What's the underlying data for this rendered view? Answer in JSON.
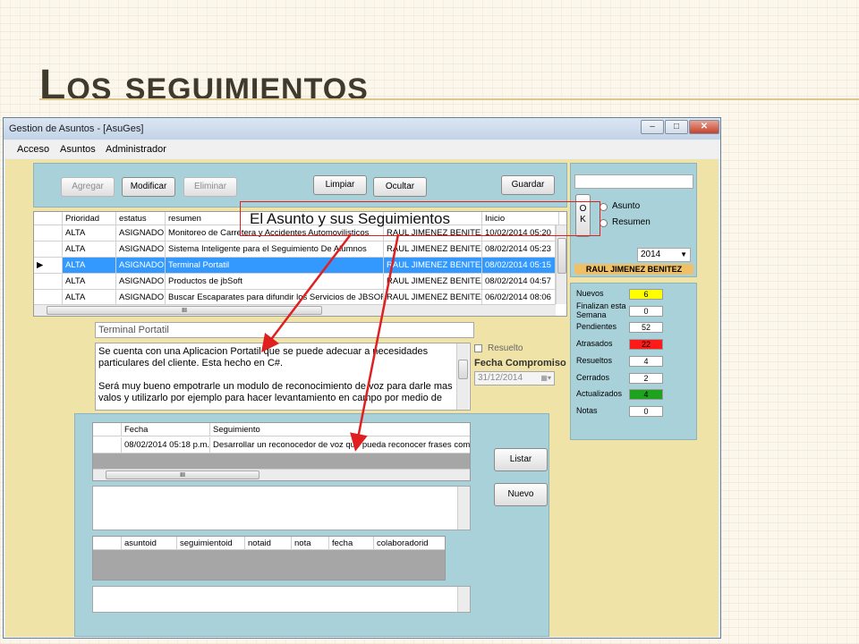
{
  "slide": {
    "title": "Los seguimientos",
    "callout": "El Asunto y sus Seguimientos"
  },
  "colors": {
    "accent_yellow": "#ffff00",
    "accent_red": "#ff1a1a",
    "accent_green": "#1fa31f",
    "selection": "#3399ff"
  },
  "window": {
    "title": "Gestion de Asuntos - [AsuGes]",
    "controls": {
      "minimize": "–",
      "maximize": "□",
      "close": "✕"
    },
    "menu": [
      "Acceso",
      "Asuntos",
      "Administrador"
    ]
  },
  "toolbar": {
    "agregar": "Agregar",
    "modificar": "Modificar",
    "eliminar": "Eliminar",
    "limpiar": "Limpiar",
    "ocultar": "Ocultar",
    "guardar": "Guardar"
  },
  "asuntos_grid": {
    "columns": [
      "Prioridad",
      "estatus",
      "resumen",
      "",
      "Inicio"
    ],
    "rows": [
      [
        "ALTA",
        "ASIGNADO",
        "Monitoreo de Carretera y Accidentes Automovilisticos",
        "RAUL JIMENEZ BENITEZ",
        "10/02/2014 05:20"
      ],
      [
        "ALTA",
        "ASIGNADO",
        "Sistema Inteligente para el Seguimiento De Alumnos",
        "RAUL JIMENEZ BENITEZ",
        "08/02/2014 05:23"
      ],
      [
        "ALTA",
        "ASIGNADO",
        "Terminal Portatil",
        "RAUL JIMENEZ BENITEZ",
        "08/02/2014 05:15"
      ],
      [
        "ALTA",
        "ASIGNADO",
        "Productos de jbSoft",
        "RAUL JIMENEZ BENITEZ",
        "08/02/2014 04:57"
      ],
      [
        "ALTA",
        "ASIGNADO",
        "Buscar Escaparates para difundir los Servicios de JBSOFT",
        "RAUL JIMENEZ BENITEZ",
        "06/02/2014 08:06"
      ]
    ],
    "selected_row": 2,
    "scroll_thumb_label": "III"
  },
  "filter": {
    "search_value": "",
    "ok_label": "O\nK",
    "radio_asunto": "Asunto",
    "radio_resumen": "Resumen",
    "year": "2014",
    "user": "RAUL JIMENEZ BENITEZ"
  },
  "stats": [
    {
      "label": "Nuevos",
      "value": "6",
      "color": "#ffff00"
    },
    {
      "label": "Finalizan esta Semana",
      "value": "0",
      "color": "#ffffff"
    },
    {
      "label": "Pendientes",
      "value": "52",
      "color": "#ffffff"
    },
    {
      "label": "Atrasados",
      "value": "22",
      "color": "#ff1a1a"
    },
    {
      "label": "Resueltos",
      "value": "4",
      "color": "#ffffff"
    },
    {
      "label": "Cerrados",
      "value": "2",
      "color": "#ffffff"
    },
    {
      "label": "Actualizados",
      "value": "4",
      "color": "#1fa31f"
    },
    {
      "label": "Notas",
      "value": "0",
      "color": "#ffffff"
    }
  ],
  "detail": {
    "resumen": "Terminal Portatil",
    "descripcion": "Se cuenta con una Aplicacion Portatil que se puede adecuar a necesidades particulares del cliente. Esta hecho en C#.\n\nSerá muy bueno empotrarle un modulo de reconocimiento de voz para darle mas valos y utilizarlo por ejemplo para hacer levantamiento en campo por medio de",
    "resuelto_label": "Resuelto",
    "fecha_compromiso_label": "Fecha Compromiso",
    "fecha_compromiso_value": "31/12/2014"
  },
  "seguimientos": {
    "columns": [
      "Fecha",
      "Seguimiento"
    ],
    "rows": [
      [
        "08/02/2014 05:18 p.m.",
        "Desarrollar un reconocedor de voz que pueda reconocer frases como \"po"
      ]
    ],
    "scroll_thumb_label": "III",
    "listar": "Listar",
    "nuevo": "Nuevo"
  },
  "notas_grid": {
    "columns": [
      "asuntoid",
      "seguimientoid",
      "notaid",
      "nota",
      "fecha",
      "colaboradorid"
    ]
  }
}
